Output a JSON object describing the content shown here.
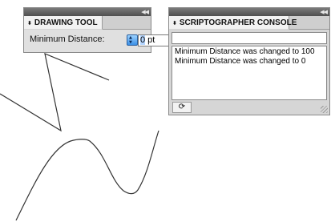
{
  "drawing_tool": {
    "title": "DRAWING TOOL",
    "min_distance_label": "Minimum Distance:",
    "min_distance_value": "0",
    "min_distance_unit": " pt"
  },
  "console": {
    "title": "SCRIPTOGRAPHER CONSOLE",
    "command_value": "",
    "output_lines": [
      "Minimum Distance was changed to 100",
      "Minimum Distance was changed to 0"
    ]
  },
  "icons": {
    "collapse": "double-chevron-left-icon",
    "tab_updown": "updown-arrows-icon",
    "refresh": "refresh-icon",
    "resize": "resize-grip-icon"
  },
  "colors": {
    "accent": "#3a8fe6",
    "selection": "#b4d5fe",
    "titlebar": "#5f5f5f",
    "stroke": "#333333"
  }
}
